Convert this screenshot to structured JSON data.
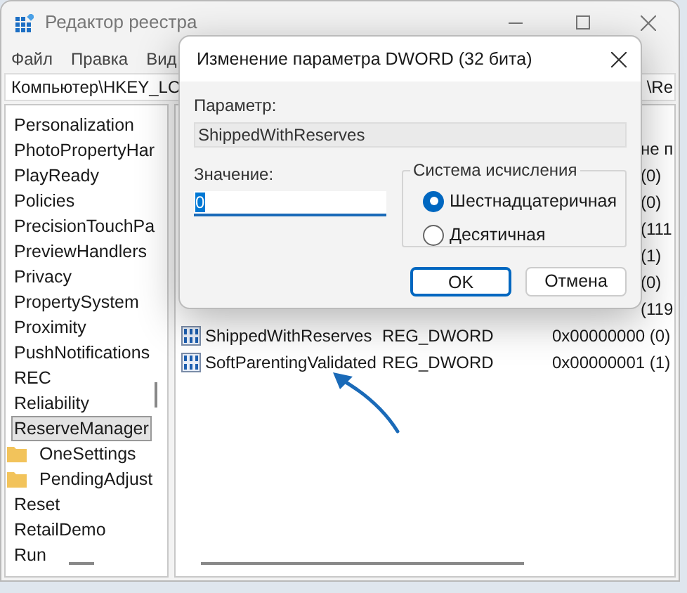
{
  "window": {
    "title": "Редактор реестра"
  },
  "menu": [
    "Файл",
    "Правка",
    "Вид"
  ],
  "address": [
    "Компьютер\\HKEY_LO",
    "\\Re"
  ],
  "tree": [
    {
      "label": "Personalization",
      "selected": false
    },
    {
      "label": "PhotoPropertyHar",
      "selected": false
    },
    {
      "label": "PlayReady",
      "selected": false
    },
    {
      "label": "Policies",
      "selected": false
    },
    {
      "label": "PrecisionTouchPa",
      "selected": false
    },
    {
      "label": "PreviewHandlers",
      "selected": false
    },
    {
      "label": "Privacy",
      "selected": false
    },
    {
      "label": "PropertySystem",
      "selected": false
    },
    {
      "label": "Proximity",
      "selected": false
    },
    {
      "label": "PushNotifications",
      "selected": false
    },
    {
      "label": "REC",
      "selected": false
    },
    {
      "label": "Reliability",
      "selected": false
    },
    {
      "label": "ReserveManager",
      "selected": true,
      "children": [
        {
          "label": "OneSettings",
          "selected": false
        },
        {
          "label": "PendingAdjust",
          "selected": false
        }
      ]
    },
    {
      "label": "Reset",
      "selected": false
    },
    {
      "label": "RetailDemo",
      "selected": false
    },
    {
      "label": "Run",
      "selected": false
    }
  ],
  "values": [
    {
      "data": "не п"
    },
    {
      "data": "(0)"
    },
    {
      "data": "(0)"
    },
    {
      "data": "(111"
    },
    {
      "data": "(1)"
    },
    {
      "data": "(0)"
    },
    {
      "data": "(119"
    },
    {
      "name": "ShippedWithReserves",
      "type": "REG_DWORD",
      "data": "0x00000000 (0)"
    },
    {
      "name": "SoftParentingValidated",
      "type": "REG_DWORD",
      "data": "0x00000001 (1)"
    }
  ],
  "dialog": {
    "title": "Изменение параметра DWORD (32 бита)",
    "name_label": "Параметр:",
    "name_value": "ShippedWithReserves",
    "value_label": "Значение:",
    "value": "0",
    "base_group": "Система исчисления",
    "bases": [
      {
        "label": "Шестнадцатеричная",
        "selected": true
      },
      {
        "label": "Десятичная",
        "selected": false
      }
    ],
    "buttons": [
      {
        "label": "OK",
        "default": true
      },
      {
        "label": "Отмена",
        "default": false
      }
    ]
  }
}
